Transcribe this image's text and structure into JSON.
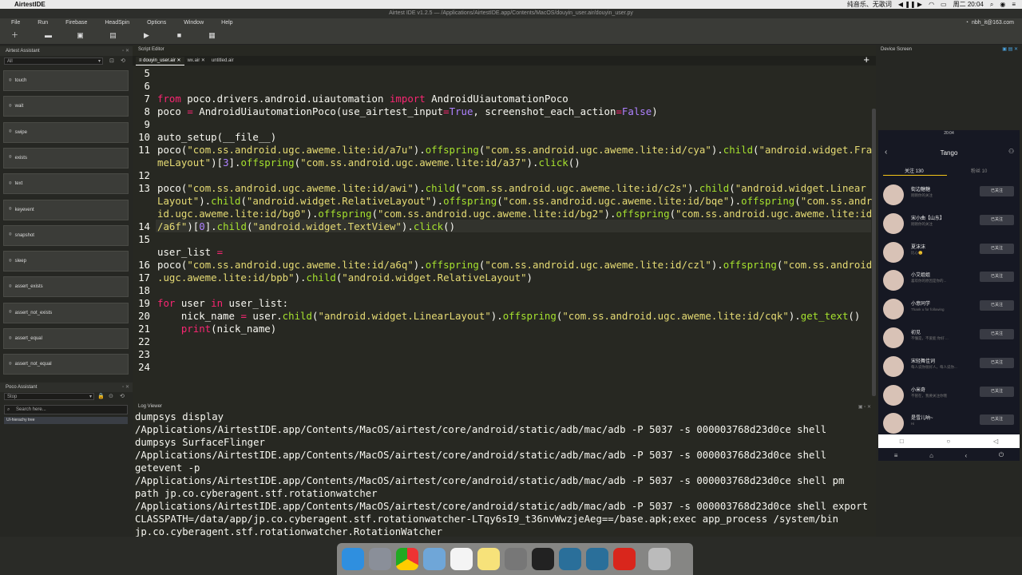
{
  "mac_menubar": {
    "app_name": "AirtestIDE",
    "status_text": "纯音乐、无歌词",
    "time": "周二 20:04"
  },
  "window_title": "Airtest IDE v1.2.5 — /Applications/AirtestIDE.app/Contents/MacOS/douyin_user.air/douyin_user.py",
  "menu": [
    "File",
    "Run",
    "Firebase",
    "HeadSpin",
    "Options",
    "Window",
    "Help"
  ],
  "account": "nbh_it@163.com",
  "airtest_assistant": {
    "title": "Airtest Assistant",
    "filter": "All",
    "buttons": [
      "touch",
      "wait",
      "swipe",
      "exists",
      "text",
      "keyevent",
      "snapshot",
      "sleep",
      "assert_exists",
      "assert_not_exists",
      "assert_equal",
      "assert_not_equal"
    ]
  },
  "poco_assistant": {
    "title": "Poco Assistant",
    "mode": "Stop",
    "search_placeholder": "Search here...",
    "tree_item": "UI-hierachy tree"
  },
  "script_editor": {
    "title": "Script Editor",
    "tabs": [
      "douyin_user.air",
      "wx.air",
      "untitled.air"
    ],
    "line_numbers": [
      "5",
      "6",
      "7",
      "8",
      "9",
      "10",
      "11",
      "",
      "12",
      "13",
      "",
      "",
      "14",
      "15",
      "",
      "16",
      "17",
      "18",
      "19",
      "20",
      "21",
      "22",
      "23",
      "24"
    ]
  },
  "log_viewer": {
    "title": "Log Viewer",
    "lines": [
      "dumpsys display",
      "/Applications/AirtestIDE.app/Contents/MacOS/airtest/core/android/static/adb/mac/adb -P 5037 -s 000003768d23d0ce shell",
      "dumpsys SurfaceFlinger",
      "/Applications/AirtestIDE.app/Contents/MacOS/airtest/core/android/static/adb/mac/adb -P 5037 -s 000003768d23d0ce shell",
      "getevent -p",
      "/Applications/AirtestIDE.app/Contents/MacOS/airtest/core/android/static/adb/mac/adb -P 5037 -s 000003768d23d0ce shell pm",
      "path jp.co.cyberagent.stf.rotationwatcher",
      "/Applications/AirtestIDE.app/Contents/MacOS/airtest/core/android/static/adb/mac/adb -P 5037 -s 000003768d23d0ce shell export",
      "CLASSPATH=/data/app/jp.co.cyberagent.stf.rotationwatcher-LTqy6sI9_t36nvWwzjeAeg==/base.apk;exec app_process /system/bin",
      "jp.co.cyberagent.stf.rotationwatcher.RotationWatcher"
    ]
  },
  "device_screen": {
    "title": "Device Screen",
    "phone_time": "20:04",
    "header_title": "Tango",
    "tab_following": "关注 130",
    "tab_fans": "粉丝 10",
    "follow_button": "已关注",
    "users": [
      {
        "name": "街边糖糖",
        "sub": "刚刚你的关注"
      },
      {
        "name": "宋小曲【山东】",
        "sub": "刚刚你的关注"
      },
      {
        "name": "夏沫沫",
        "sub": "比心😊"
      },
      {
        "name": "小艾姐姐",
        "sub": "喜欢你的原因是你的..."
      },
      {
        "name": "小意同学",
        "sub": "Thank u for following"
      },
      {
        "name": "初见",
        "sub": "不懂是，不爱能 你好 ..."
      },
      {
        "name": "宋轻舞佳词",
        "sub": "每人说你很好人，每人说你..."
      },
      {
        "name": "小米奇",
        "sub": "不管在，我要关注你哦"
      },
      {
        "name": "是雪儿呐~",
        "sub": "Hi"
      }
    ]
  }
}
